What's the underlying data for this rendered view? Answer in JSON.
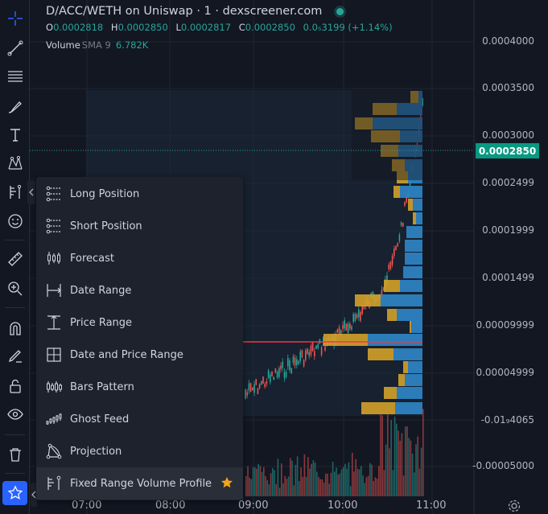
{
  "header": {
    "title": "D/ACC/WETH on Uniswap · 1 · dexscreener.com",
    "ohlc": [
      {
        "key": "O",
        "value": "0.0002818"
      },
      {
        "key": "H",
        "value": "0.0002850"
      },
      {
        "key": "L",
        "value": "0.0002817"
      },
      {
        "key": "C",
        "value": "0.0002850"
      }
    ],
    "change": "0.0₅3199 (+1.14%)",
    "volume_label": "Volume",
    "sma_label": "SMA 9",
    "volume_value": "6.782K"
  },
  "price_axis": {
    "labels": [
      "0.0004000",
      "0.0003500",
      "0.0003000",
      "0.0002499",
      "0.0001999",
      "0.0001499",
      "0.00009999",
      "0.00004999",
      "-0.01₉4065",
      "-0.00005000"
    ],
    "current_price": "0.0002850"
  },
  "time_axis": {
    "labels": [
      "07:00",
      "08:00",
      "09:00",
      "10:00",
      "11:00"
    ]
  },
  "menu": {
    "items": [
      {
        "label": "Long Position",
        "icon": "long-position-icon"
      },
      {
        "label": "Short Position",
        "icon": "short-position-icon"
      },
      {
        "label": "Forecast",
        "icon": "forecast-icon"
      },
      {
        "label": "Date Range",
        "icon": "date-range-icon"
      },
      {
        "label": "Price Range",
        "icon": "price-range-icon"
      },
      {
        "label": "Date and Price Range",
        "icon": "date-price-range-icon"
      },
      {
        "label": "Bars Pattern",
        "icon": "bars-pattern-icon"
      },
      {
        "label": "Ghost Feed",
        "icon": "ghost-feed-icon"
      },
      {
        "label": "Projection",
        "icon": "projection-icon"
      },
      {
        "label": "Fixed Range Volume Profile",
        "icon": "volume-profile-icon",
        "favorite": true
      }
    ]
  },
  "colors": {
    "background": "#131722",
    "up": "#26a69a",
    "down": "#ef5350",
    "accent": "#2962ff",
    "profile_up": "#d4a12a",
    "profile_down": "#2e86c8",
    "star": "#f7a21b"
  }
}
